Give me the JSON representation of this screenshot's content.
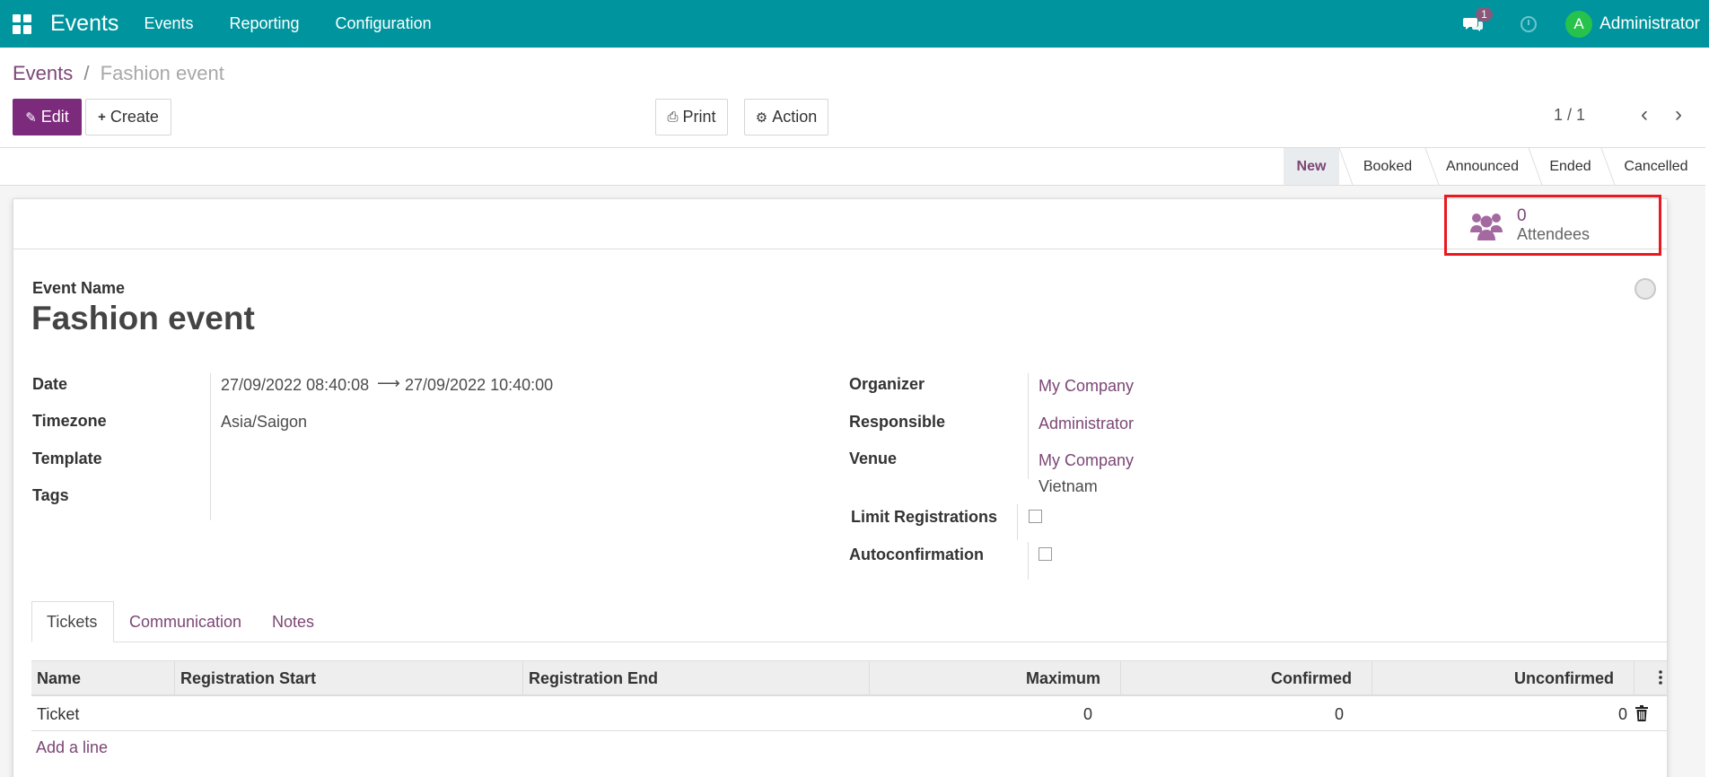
{
  "navbar": {
    "app_name": "Events",
    "menu": [
      "Events",
      "Reporting",
      "Configuration"
    ],
    "chat_badge": "1",
    "avatar_letter": "A",
    "user": "Administrator"
  },
  "breadcrumb": {
    "parent": "Events",
    "separator": "/",
    "current": "Fashion event"
  },
  "toolbar": {
    "edit": "Edit",
    "create": "Create",
    "print": "Print",
    "action": "Action",
    "pager": "1 / 1"
  },
  "stages": [
    "New",
    "Booked",
    "Announced",
    "Ended",
    "Cancelled"
  ],
  "active_stage": "New",
  "stat": {
    "value": "0",
    "label": "Attendees"
  },
  "form": {
    "event_name_label": "Event Name",
    "event_name": "Fashion event",
    "date_label": "Date",
    "date_start": "27/09/2022 08:40:08",
    "date_arrow": "⟶",
    "date_end": "27/09/2022 10:40:00",
    "timezone_label": "Timezone",
    "timezone": "Asia/Saigon",
    "template_label": "Template",
    "tags_label": "Tags",
    "organizer_label": "Organizer",
    "organizer": "My Company",
    "responsible_label": "Responsible",
    "responsible": "Administrator",
    "venue_label": "Venue",
    "venue": "My Company",
    "venue_country": "Vietnam",
    "limit_label": "Limit Registrations",
    "autoconfirm_label": "Autoconfirmation"
  },
  "tabs": [
    "Tickets",
    "Communication",
    "Notes"
  ],
  "table": {
    "headers": [
      "Name",
      "Registration Start",
      "Registration End",
      "Maximum",
      "Confirmed",
      "Unconfirmed"
    ],
    "rows": [
      {
        "name": "Ticket",
        "start": "",
        "end": "",
        "maximum": "0",
        "confirmed": "0",
        "unconfirmed": "0"
      }
    ],
    "add_line": "Add a line"
  },
  "colors": {
    "navbar": "#00959e",
    "primary": "#7c2b7c",
    "link": "#7c4675",
    "highlight": "#e8191f"
  }
}
